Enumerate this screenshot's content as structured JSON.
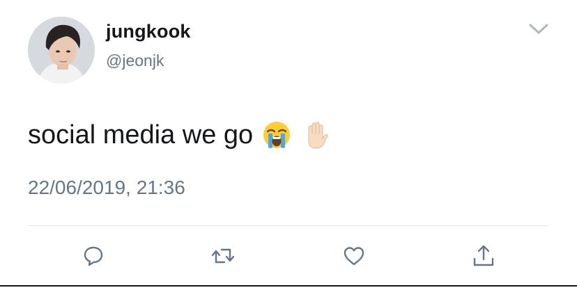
{
  "tweet": {
    "author": {
      "display_name": "jungkook",
      "handle": "@jeonjk",
      "avatar_icon": "profile-photo"
    },
    "text": "social media we go",
    "emojis": [
      "loudly-crying-face",
      "raised-hand"
    ],
    "timestamp": "22/06/2019, 21:36",
    "menu_icon": "chevron-down-icon"
  },
  "actions": [
    {
      "name": "reply",
      "icon": "comment-icon"
    },
    {
      "name": "retweet",
      "icon": "retweet-icon"
    },
    {
      "name": "like",
      "icon": "heart-icon"
    },
    {
      "name": "share",
      "icon": "share-icon"
    }
  ],
  "colors": {
    "text_primary": "#14171a",
    "text_secondary": "#657786",
    "icon": "#657786",
    "divider": "#e1e8ed"
  }
}
